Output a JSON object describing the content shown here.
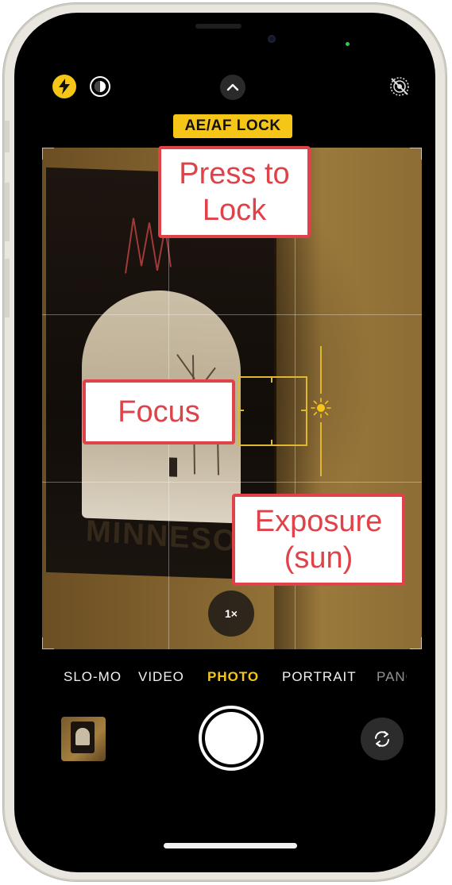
{
  "top_bar": {
    "flash_icon": "flash-bolt-icon",
    "live_photo_icon": "live-photo-icon",
    "chevron_icon": "chevron-up-icon",
    "live_off_icon": "live-photo-off-icon",
    "accent_color": "#f5c518"
  },
  "badge": {
    "label": "AE/AF LOCK"
  },
  "annotations": {
    "lock_line1": "Press to",
    "lock_line2": "Lock",
    "focus": "Focus",
    "exposure_line1": "Exposure",
    "exposure_line2": "(sun)",
    "callout_color": "#e0424a"
  },
  "zoom": {
    "label": "1×"
  },
  "modes": {
    "items": [
      "SLO-MO",
      "VIDEO",
      "PHOTO",
      "PORTRAIT",
      "PANO"
    ],
    "active": "PHOTO"
  },
  "bottom_bar": {
    "thumbnail_icon": "last-photo-thumbnail",
    "shutter_icon": "shutter-button",
    "flip_icon": "camera-flip-icon"
  }
}
